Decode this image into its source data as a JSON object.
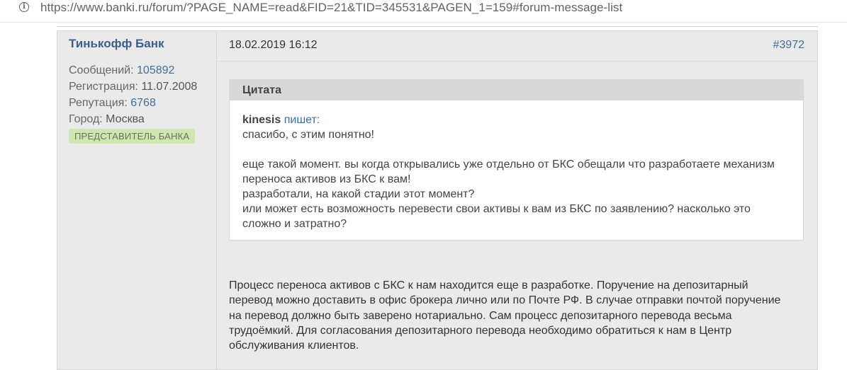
{
  "browser": {
    "url": "https://www.banki.ru/forum/?PAGE_NAME=read&FID=21&TID=345531&PAGEN_1=159#forum-message-list",
    "info_icon": "info-icon"
  },
  "author": {
    "name": "Тинькофф Банк",
    "messages_label": "Сообщений:",
    "messages_value": "105892",
    "registration_label": "Регистрация:",
    "registration_value": "11.07.2008",
    "reputation_label": "Репутация:",
    "reputation_value": "6768",
    "city_label": "Город:",
    "city_value": "Москва",
    "badge": "ПРЕДСТАВИТЕЛЬ БАНКА"
  },
  "post": {
    "datetime": "18.02.2019 16:12",
    "number": "#3972",
    "quote": {
      "title": "Цитата",
      "author": "kinesis",
      "writes": "пишет:",
      "line1": "спасибо, с этим понятно!",
      "line2": "еще такой момент. вы когда открывались уже отдельно от БКС обещали что разработаете механизм",
      "line3": "переноса активов из БКС к вам!",
      "line4": "разработали, на какой стадии этот момент?",
      "line5": "или может есть возможность перевести свои активы к вам из БКС по заявлению? насколько это",
      "line6": "сложно и затратно?"
    },
    "reply": {
      "line1": "Процесс переноса активов с БКС к нам находится еще в разработке. Поручение на депозитарный",
      "line2": "перевод можно доставить в офис брокера лично или по Почте РФ. В случае отправки почтой поручение",
      "line3": "на перевод должно быть заверено нотариально. Сам процесс депозитарного перевода весьма",
      "line4": "трудоёмкий. Для согласования депозитарного перевода необходимо обратиться к нам в Центр",
      "line5": "обслуживания клиентов."
    }
  },
  "colors": {
    "link": "#3f6f9c",
    "author_name": "#3e6088",
    "badge_bg": "#cfe6b0",
    "post_bg": "#eaeaea",
    "quote_head_bg": "#d8d8d8"
  }
}
